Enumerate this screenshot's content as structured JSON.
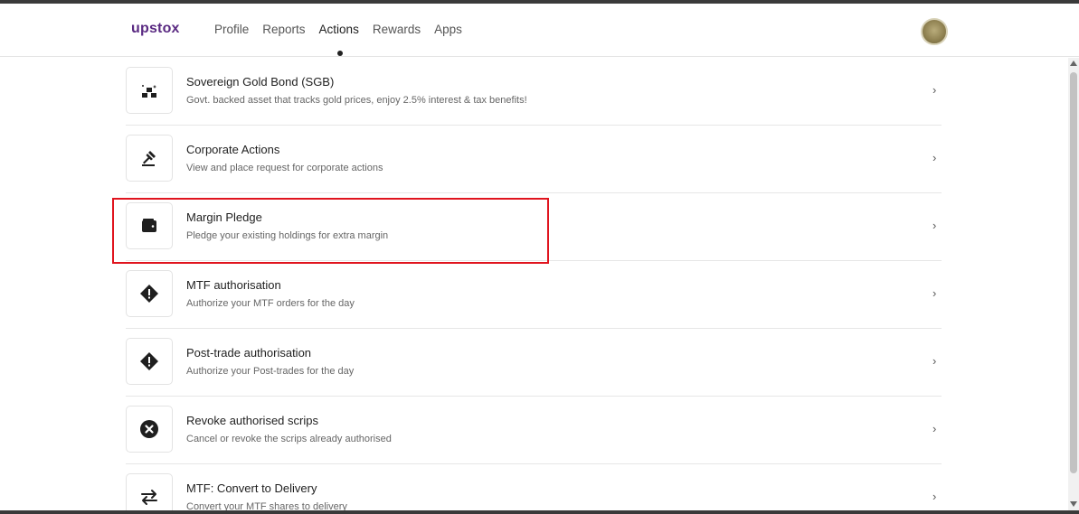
{
  "header": {
    "logo": "upstox",
    "nav": [
      {
        "label": "Profile",
        "active": false
      },
      {
        "label": "Reports",
        "active": false
      },
      {
        "label": "Actions",
        "active": true
      },
      {
        "label": "Rewards",
        "active": false
      },
      {
        "label": "Apps",
        "active": false
      }
    ],
    "avatar_icon": "user-avatar"
  },
  "actions": [
    {
      "title": "Sovereign Gold Bond (SGB)",
      "description": "Govt. backed asset that tracks gold prices, enjoy 2.5% interest & tax benefits!",
      "icon": "gold-bars-icon"
    },
    {
      "title": "Corporate Actions",
      "description": "View and place request for corporate actions",
      "icon": "gavel-icon"
    },
    {
      "title": "Margin Pledge",
      "description": "Pledge your existing holdings for extra margin",
      "icon": "wallet-icon"
    },
    {
      "title": "MTF authorisation",
      "description": "Authorize your MTF orders for the day",
      "icon": "warning-diamond-icon"
    },
    {
      "title": "Post-trade authorisation",
      "description": "Authorize your Post-trades for the day",
      "icon": "warning-diamond-icon"
    },
    {
      "title": "Revoke authorised scrips",
      "description": "Cancel or revoke the scrips already authorised",
      "icon": "close-circle-icon"
    },
    {
      "title": "MTF: Convert to Delivery",
      "description": "Convert your MTF shares to delivery",
      "icon": "swap-arrows-icon"
    }
  ],
  "chevron": "›",
  "colors": {
    "brand": "#5a2a82",
    "highlight": "#e0141e"
  }
}
